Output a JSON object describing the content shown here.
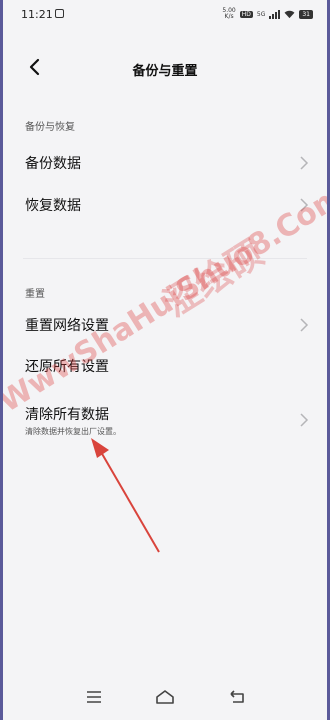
{
  "status_bar": {
    "time": "11:21",
    "speed_value": "5.00",
    "speed_unit": "K/s",
    "hd": "HD",
    "network": "5G",
    "battery": "31"
  },
  "header": {
    "title": "备份与重置"
  },
  "sections": [
    {
      "label": "备份与恢复",
      "items": [
        {
          "label": "备份数据"
        },
        {
          "label": "恢复数据"
        }
      ]
    },
    {
      "label": "重置",
      "items": [
        {
          "label": "重置网络设置"
        },
        {
          "label": "还原所有设置"
        },
        {
          "label": "清除所有数据",
          "subtitle": "清除数据并恢复出厂设置。"
        }
      ]
    }
  ],
  "watermark": {
    "text": "WwwShaHuiShuo8.Com",
    "text_cn": "涩绘硕"
  },
  "icons": [
    "back-arrow-icon",
    "chevron-right-icon",
    "menu-icon",
    "home-icon",
    "return-icon"
  ],
  "colors": {
    "background": "#f4f4f6",
    "annotation_arrow": "#d9443c",
    "watermark": "#dc3c3c"
  }
}
